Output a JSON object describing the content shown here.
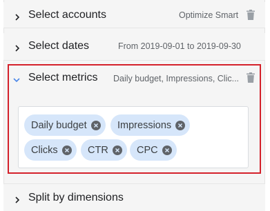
{
  "sections": [
    {
      "title": "Select accounts",
      "summary": "Optimize Smart",
      "expanded": false,
      "has_delete": true
    },
    {
      "title": "Select dates",
      "summary": "From 2019-09-01 to 2019-09-30",
      "expanded": false,
      "has_delete": false
    },
    {
      "title": "Select metrics",
      "summary": "Daily budget, Impressions, Clic...",
      "expanded": true,
      "has_delete": true
    },
    {
      "title": "Split by dimensions",
      "summary": "",
      "expanded": false,
      "has_delete": false
    }
  ],
  "metrics_chips": [
    {
      "label": "Daily budget"
    },
    {
      "label": "Impressions"
    },
    {
      "label": "Clicks"
    },
    {
      "label": "CTR"
    },
    {
      "label": "CPC"
    }
  ],
  "colors": {
    "accent_blue": "#4a86e8",
    "highlight_red": "#d4202a",
    "chip_bg": "#d6e6fa",
    "chip_icon": "#5f6368"
  }
}
